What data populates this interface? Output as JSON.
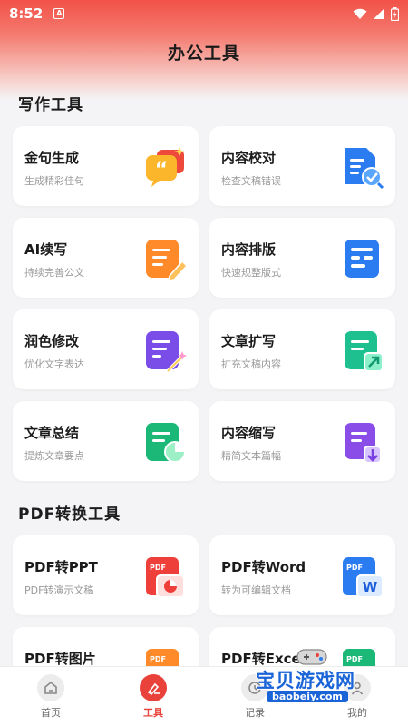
{
  "status_bar": {
    "time": "8:52",
    "badge": "A"
  },
  "header": {
    "title": "办公工具"
  },
  "sections": [
    {
      "title": "写作工具",
      "cards": [
        {
          "title": "金句生成",
          "subtitle": "生成精彩佳句",
          "icon": "quote-bubble-icon"
        },
        {
          "title": "内容校对",
          "subtitle": "检查文稿错误",
          "icon": "doc-check-icon"
        },
        {
          "title": "AI续写",
          "subtitle": "持续完善公文",
          "icon": "doc-pencil-icon"
        },
        {
          "title": "内容排版",
          "subtitle": "快速规整版式",
          "icon": "doc-layout-icon"
        },
        {
          "title": "润色修改",
          "subtitle": "优化文字表达",
          "icon": "doc-magic-icon"
        },
        {
          "title": "文章扩写",
          "subtitle": "扩充文稿内容",
          "icon": "doc-expand-icon"
        },
        {
          "title": "文章总结",
          "subtitle": "提炼文章要点",
          "icon": "doc-pie-icon"
        },
        {
          "title": "内容缩写",
          "subtitle": "精简文本篇幅",
          "icon": "doc-shrink-icon"
        }
      ]
    },
    {
      "title": "PDF转换工具",
      "cards": [
        {
          "title": "PDF转PPT",
          "subtitle": "PDF转演示文稿",
          "icon": "pdf-ppt-icon",
          "badge": "PDF"
        },
        {
          "title": "PDF转Word",
          "subtitle": "转为可编辑文档",
          "icon": "pdf-word-icon",
          "badge": "PDF",
          "badge2": "W"
        },
        {
          "title": "PDF转图片",
          "subtitle": "",
          "icon": "pdf-image-icon",
          "badge": "PDF"
        },
        {
          "title": "PDF转Excel",
          "subtitle": "",
          "icon": "pdf-excel-icon",
          "badge": "PDF"
        }
      ]
    }
  ],
  "bottom_nav": [
    {
      "label": "首页",
      "icon": "home-icon"
    },
    {
      "label": "工具",
      "icon": "tools-icon",
      "active": true
    },
    {
      "label": "记录",
      "icon": "record-icon"
    },
    {
      "label": "我的",
      "icon": "profile-icon"
    }
  ],
  "watermark": {
    "text": "宝贝游戏网",
    "url": "baobeiy.com"
  },
  "colors": {
    "accent": "#e8423a",
    "background": "#f4f4f6"
  }
}
